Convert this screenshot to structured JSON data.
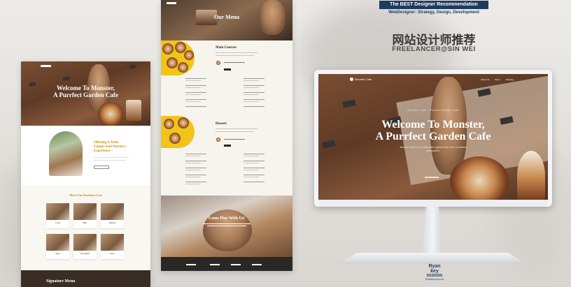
{
  "colors": {
    "accent": "#f2c418",
    "header_bar": "#1f3a5f",
    "dark": "#2b2724",
    "cream": "#f7f4ee"
  },
  "header": {
    "badge": "The BEST Designer Recommendation",
    "tagline": "WebDesigner: Strategy, Design, Development",
    "title_cn": "网站设计师推荐",
    "subtitle": "FREELANCER@SIN WEI"
  },
  "left_page": {
    "hero_title_1": "Welcome To Monster,",
    "hero_title_2": "A Purrfect Garden Cafe",
    "offer_title_1": "Offering A Truly",
    "offer_title_2": "Unique And Purrfect",
    "offer_title_3": "Experience",
    "meet_title": "Meet Our Resident Cats",
    "signature": "Signature Menu"
  },
  "middle_page": {
    "menu_title": "Our Menu",
    "main_courses": "Main Courses",
    "dessert": "Dessert",
    "hours_title": "Come Play With Us!"
  },
  "monitor": {
    "logo": "Monster Cafe",
    "nav": [
      "About Us",
      "Menu",
      "Booking"
    ],
    "eyebrow": "Monster Cafe · Perfect Garden Cafe",
    "hero_1": "Welcome To Monster,",
    "hero_2": "A Purrfect Garden Cafe",
    "desc": "Monster Cafe is a cat cafe with a garden feel, set in a relaxed atmosphere."
  },
  "brand": {
    "line1": "Ryan",
    "line2": "key",
    "line3": "DESIGNS",
    "url": "Ryankey.com.my"
  }
}
